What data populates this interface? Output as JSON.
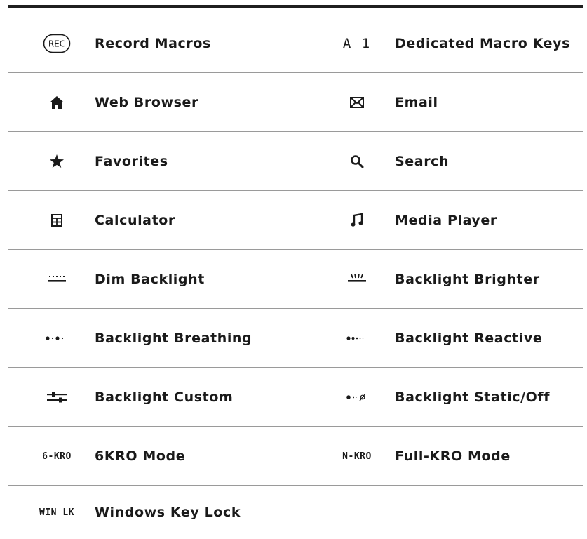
{
  "rows": [
    {
      "left": {
        "icon": "rec-icon",
        "icon_text": "REC",
        "label": "Record Macros"
      },
      "right": {
        "icon": "a1-icon",
        "icon_text": "A 1",
        "label": "Dedicated Macro Keys"
      }
    },
    {
      "left": {
        "icon": "home-icon",
        "label": "Web Browser"
      },
      "right": {
        "icon": "envelope-icon",
        "label": "Email"
      }
    },
    {
      "left": {
        "icon": "star-icon",
        "label": "Favorites"
      },
      "right": {
        "icon": "search-icon",
        "label": "Search"
      }
    },
    {
      "left": {
        "icon": "calculator-icon",
        "label": "Calculator"
      },
      "right": {
        "icon": "music-note-icon",
        "label": "Media Player"
      }
    },
    {
      "left": {
        "icon": "dim-backlight-icon",
        "label": "Dim Backlight"
      },
      "right": {
        "icon": "bright-backlight-icon",
        "label": "Backlight Brighter"
      }
    },
    {
      "left": {
        "icon": "breathing-icon",
        "label": "Backlight Breathing"
      },
      "right": {
        "icon": "reactive-icon",
        "label": "Backlight Reactive"
      }
    },
    {
      "left": {
        "icon": "sliders-icon",
        "label": "Backlight Custom"
      },
      "right": {
        "icon": "static-off-icon",
        "label": "Backlight Static/Off"
      }
    },
    {
      "left": {
        "icon": "6kro-icon",
        "icon_text": "6-KRO",
        "label": "6KRO Mode"
      },
      "right": {
        "icon": "nkro-icon",
        "icon_text": "N-KRO",
        "label": "Full-KRO Mode"
      }
    },
    {
      "left": {
        "icon": "win-lock-icon",
        "icon_text": "WIN LK",
        "label": "Windows Key Lock"
      }
    }
  ],
  "colors": {
    "text": "#1a1a1a",
    "rule": "#1f1f1f",
    "divider": "#9a9a9a"
  }
}
